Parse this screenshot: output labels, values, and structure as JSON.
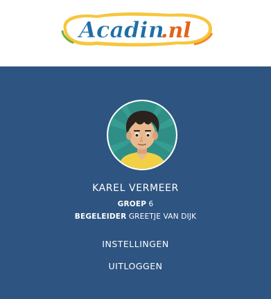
{
  "header": {
    "logo": {
      "text_main": "Acadin",
      "text_suffix": ".nl",
      "colors": {
        "letters": "#1e6fa6",
        "suffix": "#e2651a",
        "outline_outer": "#f6c63c",
        "outline_inner": "#ffffff",
        "edge_green": "#6fb13a",
        "edge_orange": "#f08a2a"
      }
    }
  },
  "profile": {
    "avatar_icon": "boy-avatar-icon",
    "name": "KAREL VERMEER",
    "group_label": "GROEP",
    "group_value": "6",
    "mentor_label": "BEGELEIDER",
    "mentor_value": "GREETJE VAN DIJK"
  },
  "menu": {
    "settings_label": "INSTELLINGEN",
    "logout_label": "UITLOGGEN"
  },
  "colors": {
    "panel_bg": "#2e5481",
    "text": "#ffffff",
    "avatar_bg": "#2f8f86"
  }
}
